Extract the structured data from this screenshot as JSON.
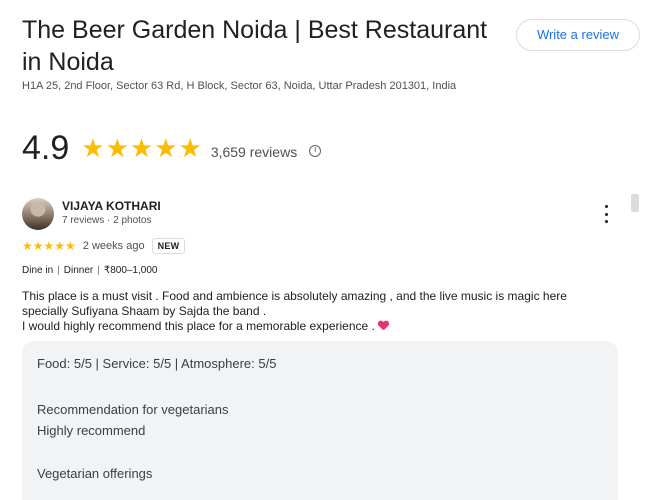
{
  "place": {
    "title": "The Beer Garden Noida | Best Restaurant in Noida",
    "address": "H1A 25, 2nd Floor, Sector 63 Rd, H Block, Sector 63, Noida, Uttar Pradesh 201301, India",
    "write_review_label": "Write a review",
    "rating": "4.9",
    "rating_stars": "★★★★★",
    "review_count": "3,659 reviews"
  },
  "review": {
    "name": "VIJAYA KOTHARI",
    "meta": "7 reviews · 2 photos",
    "stars": "★★★★★",
    "date": "2 weeks ago",
    "badge": "NEW",
    "tags": [
      "Dine in",
      "Dinner",
      "₹800–1,000"
    ],
    "text_lines": [
      "This place is a must visit . Food and ambience is absolutely amazing , and the live music is magic here",
      "specially Sufiyana Shaam by Sajda the band .",
      "I would highly recommend this place for a memorable experience ."
    ],
    "details": {
      "ratings_line": "Food: 5/5  |  Service: 5/5  |  Atmosphere: 5/5",
      "rec_label": "Recommendation for vegetarians",
      "rec_value": "Highly recommend",
      "veg_label": "Vegetarian offerings"
    }
  },
  "colors": {
    "star": "#fbbc04",
    "link": "#1a73e8",
    "heart": "#e8336d"
  },
  "icons": {
    "info": "info-icon",
    "more": "more-vert-icon",
    "heart": "heart-emoji-icon"
  }
}
